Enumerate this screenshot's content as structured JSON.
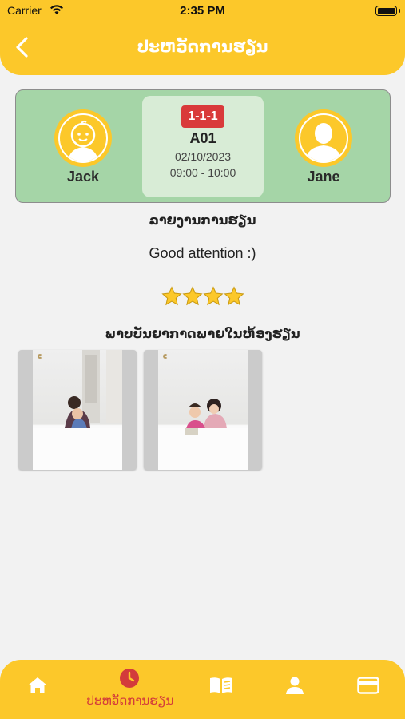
{
  "status_bar": {
    "carrier": "Carrier",
    "time": "2:35 PM"
  },
  "header": {
    "title": "ປະຫວັດການຮຽນ",
    "background": "#fcc82a"
  },
  "session_card": {
    "student": {
      "name": "Jack",
      "avatar": "baby-face-icon"
    },
    "teacher": {
      "name": "Jane",
      "avatar": "person-silhouette-icon"
    },
    "badge": "1-1-1",
    "room": "A01",
    "date": "02/10/2023",
    "time": "09:00 - 10:00",
    "background": "#a5d5a7",
    "badge_color": "#d93a3a"
  },
  "report": {
    "title": "ລາຍງານການຮຽນ",
    "text": "Good attention :)",
    "rating": 4,
    "rating_max": 4
  },
  "photos": {
    "title": "ພາບບັນຍາກາດພາຍໃນຫ້ອງຮຽນ",
    "count": 2
  },
  "tab_bar": {
    "active_label": "ປະຫວັດການຮຽນ",
    "tabs": [
      {
        "icon": "home-icon",
        "active": false
      },
      {
        "icon": "clock-icon",
        "active": true
      },
      {
        "icon": "book-icon",
        "active": false
      },
      {
        "icon": "profile-icon",
        "active": false
      },
      {
        "icon": "credit-card-icon",
        "active": false
      }
    ],
    "active_color": "#d33b3b",
    "icon_color": "#ffffff"
  }
}
